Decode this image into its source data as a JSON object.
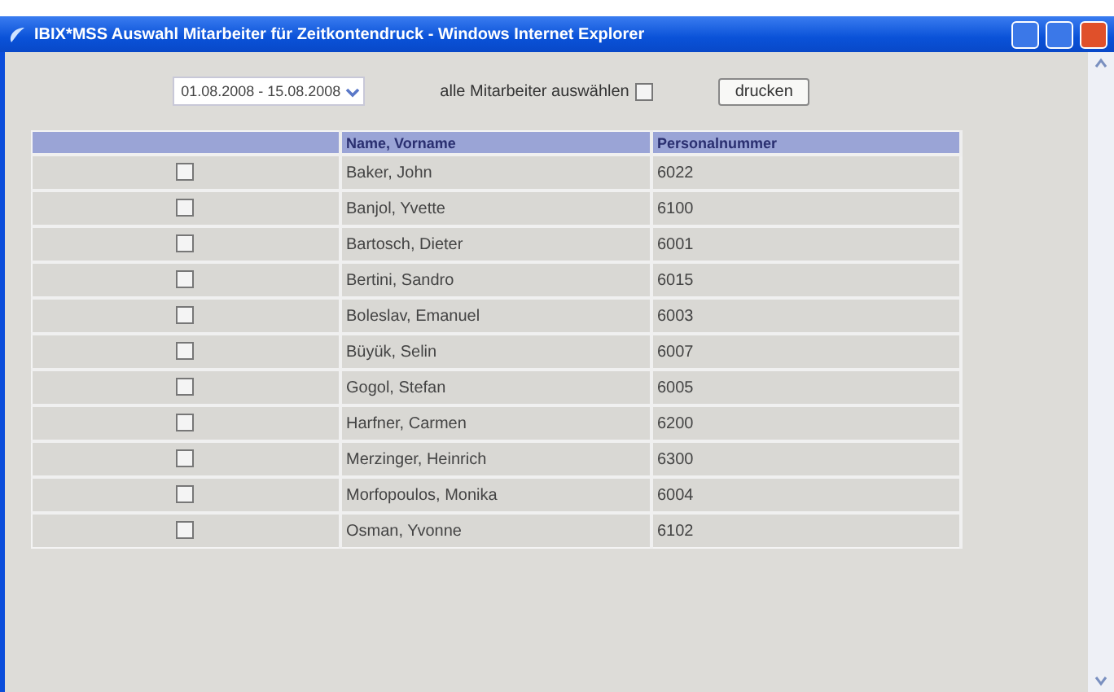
{
  "window": {
    "title": "IBIX*MSS Auswahl Mitarbeiter für Zeitkontendruck - Windows Internet Explorer"
  },
  "toolbar": {
    "period": "01.08.2008 - 15.08.2008",
    "select_all_label": "alle Mitarbeiter auswählen",
    "select_all_checked": false,
    "print_button": "drucken"
  },
  "table": {
    "columns": [
      "Name, Vorname",
      "Personalnummer"
    ],
    "rows": [
      {
        "name": "Baker, John",
        "number": "6022",
        "checked": false
      },
      {
        "name": "Banjol, Yvette",
        "number": "6100",
        "checked": false
      },
      {
        "name": "Bartosch, Dieter",
        "number": "6001",
        "checked": false
      },
      {
        "name": "Bertini, Sandro",
        "number": "6015",
        "checked": false
      },
      {
        "name": "Boleslav, Emanuel",
        "number": "6003",
        "checked": false
      },
      {
        "name": "Büyük, Selin",
        "number": "6007",
        "checked": false
      },
      {
        "name": "Gogol, Stefan",
        "number": "6005",
        "checked": false
      },
      {
        "name": "Harfner, Carmen",
        "number": "6200",
        "checked": false
      },
      {
        "name": "Merzinger, Heinrich",
        "number": "6300",
        "checked": false
      },
      {
        "name": "Morfopoulos, Monika",
        "number": "6004",
        "checked": false
      },
      {
        "name": "Osman, Yvonne",
        "number": "6102",
        "checked": false
      }
    ]
  }
}
